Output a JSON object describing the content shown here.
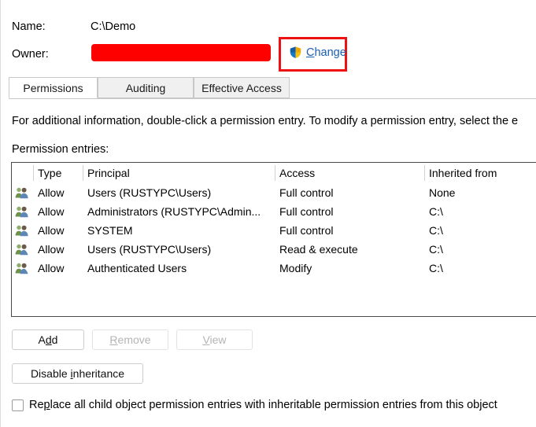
{
  "header": {
    "name_label": "Name:",
    "name_value": "C:\\Demo",
    "owner_label": "Owner:",
    "owner_value_redacted": "",
    "change_link": "Change",
    "change_accelerator": "C",
    "shield_icon": "uac-shield-icon",
    "highlight_color": "#ee1111",
    "redaction_color": "#fe0000",
    "link_color": "#1a5fb4"
  },
  "tabs": [
    {
      "label": "Permissions",
      "active": true
    },
    {
      "label": "Auditing",
      "active": false
    },
    {
      "label": "Effective Access",
      "active": false
    }
  ],
  "body": {
    "info_text": "For additional information, double-click a permission entry. To modify a permission entry, select the e",
    "entries_label": "Permission entries:"
  },
  "table": {
    "columns": [
      "Type",
      "Principal",
      "Access",
      "Inherited from"
    ],
    "rows": [
      {
        "icon": "users-group-icon",
        "type": "Allow",
        "principal": "Users (RUSTYPC\\Users)",
        "access": "Full control",
        "inherited": "None"
      },
      {
        "icon": "users-group-icon",
        "type": "Allow",
        "principal": "Administrators (RUSTYPC\\Admin...",
        "access": "Full control",
        "inherited": "C:\\"
      },
      {
        "icon": "users-group-icon",
        "type": "Allow",
        "principal": "SYSTEM",
        "access": "Full control",
        "inherited": "C:\\"
      },
      {
        "icon": "users-group-icon",
        "type": "Allow",
        "principal": "Users (RUSTYPC\\Users)",
        "access": "Read & execute",
        "inherited": "C:\\"
      },
      {
        "icon": "users-group-icon",
        "type": "Allow",
        "principal": "Authenticated Users",
        "access": "Modify",
        "inherited": "C:\\"
      }
    ]
  },
  "buttons": {
    "add": {
      "label": "Add",
      "accelerator": "d",
      "enabled": true
    },
    "remove": {
      "label": "Remove",
      "accelerator": "R",
      "enabled": false
    },
    "view": {
      "label": "View",
      "accelerator": "V",
      "enabled": false
    },
    "disable_inheritance": {
      "label": "Disable inheritance",
      "accelerator": "i",
      "enabled": true
    }
  },
  "checkbox": {
    "label": "Replace all child object permission entries with inheritable permission entries from this object",
    "accelerator": "p",
    "checked": false
  }
}
